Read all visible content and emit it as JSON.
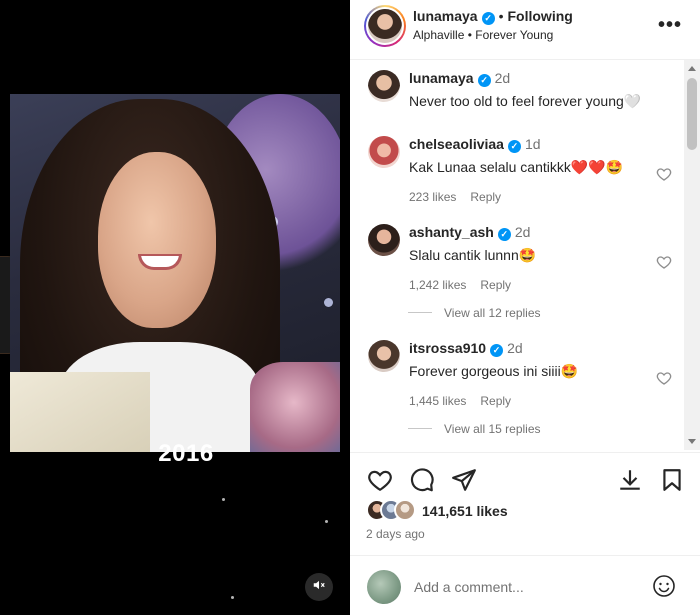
{
  "media": {
    "overlay_text": "2016"
  },
  "header": {
    "username": "lunamaya",
    "separator": "•",
    "follow_status": "Following",
    "audio": "Alphaville • Forever Young",
    "more": "•••"
  },
  "caption": {
    "username": "lunamaya",
    "age": "2d",
    "text": "Never too old to feel forever young🤍"
  },
  "comments": [
    {
      "username": "chelseaoliviaa",
      "age": "1d",
      "text": "Kak Lunaa selalu cantikkk❤️❤️🤩",
      "likes": "223 likes",
      "reply": "Reply"
    },
    {
      "username": "ashanty_ash",
      "age": "2d",
      "text": "Slalu cantik lunnn🤩",
      "likes": "1,242 likes",
      "reply": "Reply",
      "view_replies": "View all 12 replies"
    },
    {
      "username": "itsrossa910",
      "age": "2d",
      "text": "Forever gorgeous ini siiii🤩",
      "likes": "1,445 likes",
      "reply": "Reply",
      "view_replies": "View all 15 replies"
    }
  ],
  "actions": {
    "likes": "141,651 likes",
    "date": "2 days ago"
  },
  "composer": {
    "placeholder": "Add a comment..."
  },
  "colors": {
    "verified": "#0095f6",
    "muted_text": "#737373",
    "primary_text": "#262626"
  },
  "icons": [
    "heart-icon",
    "comment-icon",
    "share-icon",
    "download-icon",
    "bookmark-icon",
    "mute-icon",
    "emoji-icon",
    "more-icon",
    "verified-icon"
  ]
}
